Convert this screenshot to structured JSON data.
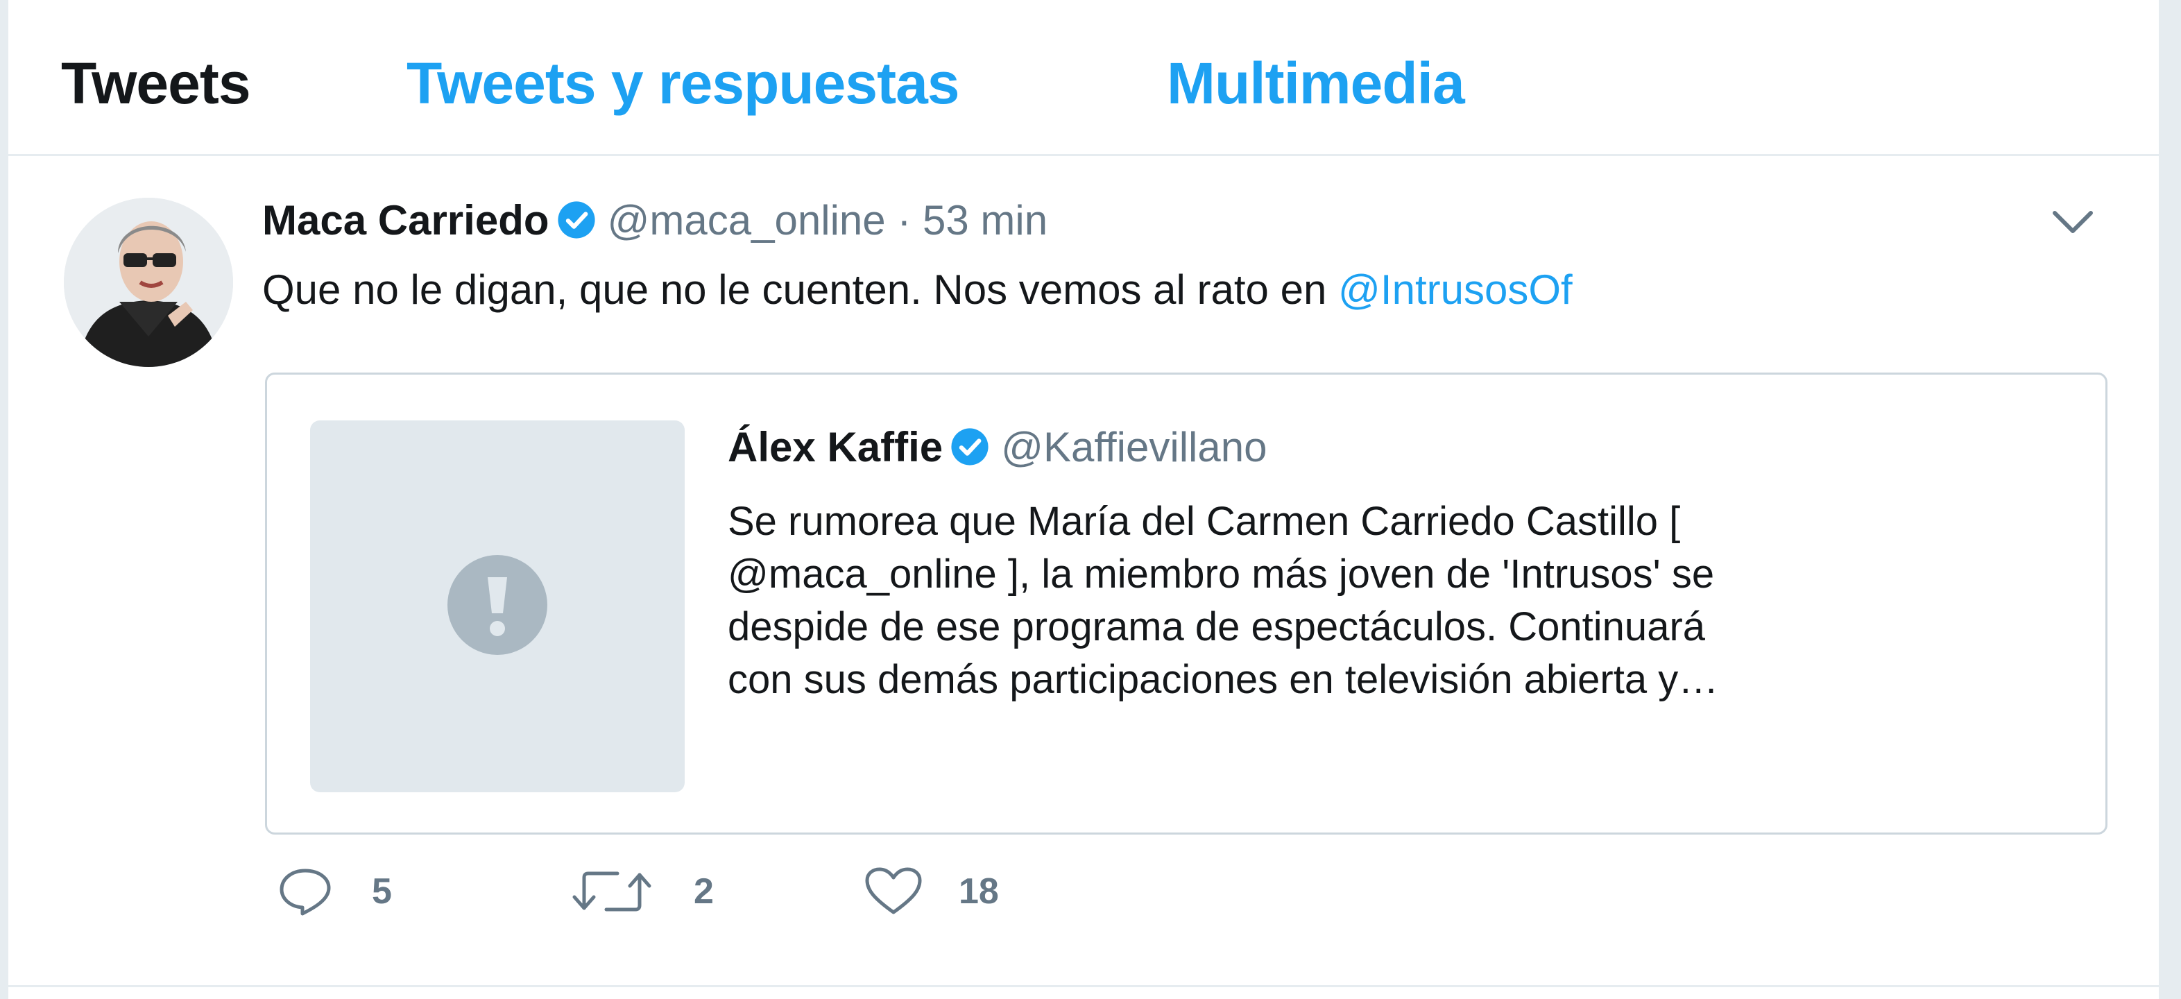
{
  "tabs": [
    {
      "label": "Tweets"
    },
    {
      "label": "Tweets y respuestas"
    },
    {
      "label": "Multimedia"
    }
  ],
  "tweet": {
    "author_name": "Maca Carriedo",
    "handle": "@maca_online",
    "separator": "·",
    "time": "53 min",
    "text_before_mention": "Que no le digan, que no le cuenten. Nos vemos al rato en ",
    "mention": "@IntrusosOf",
    "quoted": {
      "author_name": "Álex Kaffie",
      "handle": "@Kaffievillano",
      "text_lines": [
        "Se rumorea que María del Carmen Carriedo Castillo [",
        "@maca_online ], la miembro más joven de 'Intrusos' se",
        "despide de ese programa de espectáculos. Continuará",
        "con sus demás participaciones en televisión abierta y…"
      ]
    },
    "actions": {
      "replies": "5",
      "retweets": "2",
      "likes": "18"
    }
  },
  "colors": {
    "accent": "#1da1f2",
    "text": "#14171a",
    "secondary": "#657786",
    "border": "#ccd6dd",
    "media_placeholder": "#e1e8ed"
  },
  "icons": {
    "verified": "verified-badge-icon",
    "caret": "chevron-down-icon",
    "media": "exclamation-icon",
    "reply": "reply-icon",
    "retweet": "retweet-icon",
    "like": "heart-icon"
  }
}
